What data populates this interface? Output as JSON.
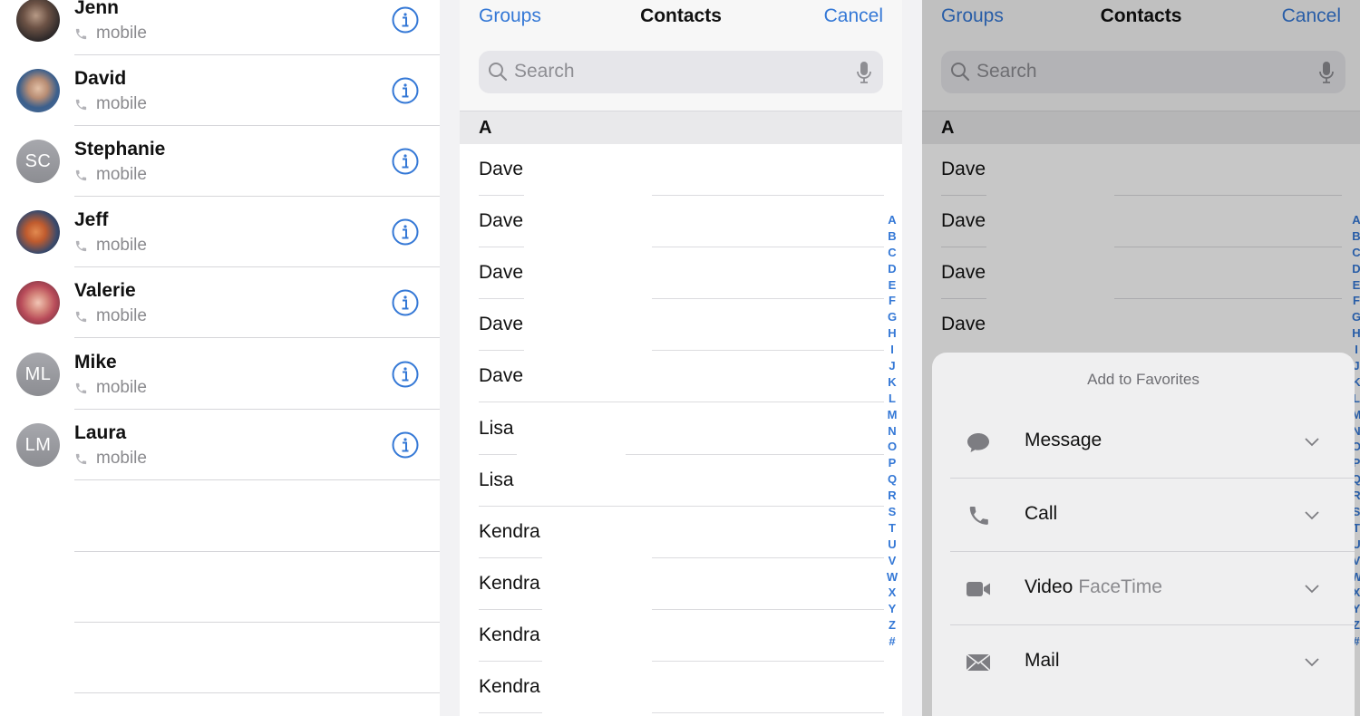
{
  "favorites": {
    "rows": [
      {
        "name": "Jenn",
        "sub": "mobile",
        "avatar": "photo"
      },
      {
        "name": "David",
        "sub": "mobile",
        "avatar": "photo"
      },
      {
        "name": "Stephanie",
        "sub": "mobile",
        "avatar": "initials",
        "initials": "SC"
      },
      {
        "name": "Jeff",
        "sub": "mobile",
        "avatar": "photo"
      },
      {
        "name": "Valerie",
        "sub": "mobile",
        "avatar": "photo"
      },
      {
        "name": "Mike",
        "sub": "mobile",
        "avatar": "initials",
        "initials": "ML"
      },
      {
        "name": "Laura",
        "sub": "mobile",
        "avatar": "initials",
        "initials": "LM"
      }
    ]
  },
  "contacts_picker": {
    "nav": {
      "groups": "Groups",
      "title": "Contacts",
      "cancel": "Cancel"
    },
    "search": {
      "placeholder": "Search"
    },
    "section": "A",
    "rows": [
      "Dave",
      "Dave",
      "Dave",
      "Dave",
      "Dave",
      "Lisa",
      "Lisa",
      "Kendra",
      "Kendra",
      "Kendra",
      "Kendra"
    ],
    "index": [
      "A",
      "B",
      "C",
      "D",
      "E",
      "F",
      "G",
      "H",
      "I",
      "J",
      "K",
      "L",
      "M",
      "N",
      "O",
      "P",
      "Q",
      "R",
      "S",
      "T",
      "U",
      "V",
      "W",
      "X",
      "Y",
      "Z",
      "#"
    ]
  },
  "favorites_sheet": {
    "nav": {
      "groups": "Groups",
      "title": "Contacts",
      "cancel": "Cancel"
    },
    "search": {
      "placeholder": "Search"
    },
    "section": "A",
    "rows": [
      "Dave",
      "Dave",
      "Dave",
      "Dave"
    ],
    "title": "Add to Favorites",
    "actions": [
      {
        "label": "Message",
        "sub": "",
        "icon": "message-bubble-icon"
      },
      {
        "label": "Call",
        "sub": "",
        "icon": "phone-icon"
      },
      {
        "label": "Video",
        "sub": "FaceTime",
        "icon": "video-camera-icon"
      },
      {
        "label": "Mail",
        "sub": "",
        "icon": "envelope-icon"
      }
    ]
  },
  "colors": {
    "accent": "#3478d6",
    "secondary_text": "#8a8a8e",
    "separator": "#d6d6da"
  }
}
